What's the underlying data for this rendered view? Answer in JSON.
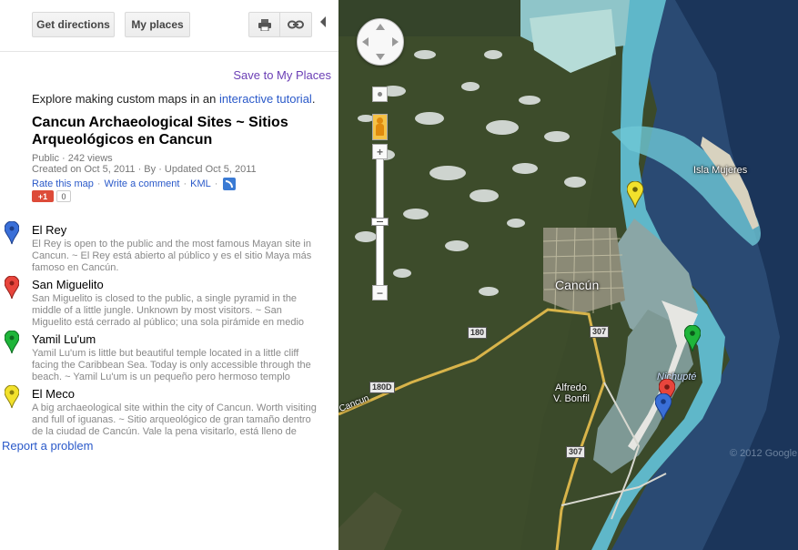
{
  "toolbar": {
    "get_directions": "Get directions",
    "my_places": "My places"
  },
  "panel": {
    "save_link": "Save to My Places",
    "explore_text": "Explore making custom maps in an",
    "explore_link": "interactive tutorial",
    "explore_end": ".",
    "map_title": "Cancun Archaeological Sites ~ Sitios Arqueológicos en Cancun",
    "meta_line1": "Public · 242 views",
    "meta_line2": "Created on Oct 5, 2011 · By  · Updated Oct 5, 2011",
    "rate_link": "Rate this map",
    "comment_link": "Write a comment",
    "kml_link": "KML",
    "plusone_label": "+1",
    "plusone_count": "0",
    "report_link": "Report a problem"
  },
  "places": [
    {
      "name": "El Rey",
      "color": "#3a6fd8",
      "description": "El Rey is open to the public and the most famous Mayan site in Cancun. ~ El Rey está abierto al público y es el sitio Maya más famoso en Cancún."
    },
    {
      "name": "San Miguelito",
      "color": "#e8453c",
      "description": "San Miguelito is closed to the public, a single pyramid in the middle of a little jungle. Unknown by most visitors. ~ San Miguelito está cerrado al público; una sola pirámide en medio de una pequeña..."
    },
    {
      "name": "Yamil Lu'um",
      "color": "#1fb53a",
      "description": "Yamil Lu'um is little but beautiful temple located in a little cliff facing the Caribbean Sea. Today is only accessible through the  beach. ~ Yamil Lu'um is un pequeño pero hermoso templo ubicado en u..."
    },
    {
      "name": "El Meco",
      "color": "#f2e12c",
      "description": "A big archaeological site within the city of Cancun. Worth visiting and full of iguanas. ~ Sitio arqueológico de gran tamaño dentro de la ciudad de Cancún. Vale la pena visitarlo, está lleno de iguanas..."
    }
  ],
  "map": {
    "labels": {
      "isla_mujeres": "Isla Mujeres",
      "cancun": "Cancún",
      "nichupte": "Nichupté",
      "alfredo": "Alfredo",
      "bonfil": "V. Bonfil",
      "cancun_road": "Cancun"
    },
    "roads": {
      "r180": "180",
      "r180d": "180D",
      "r307a": "307",
      "r307b": "307"
    },
    "copyright": "© 2012 Google",
    "zoom_in": "+",
    "zoom_out": "−"
  }
}
